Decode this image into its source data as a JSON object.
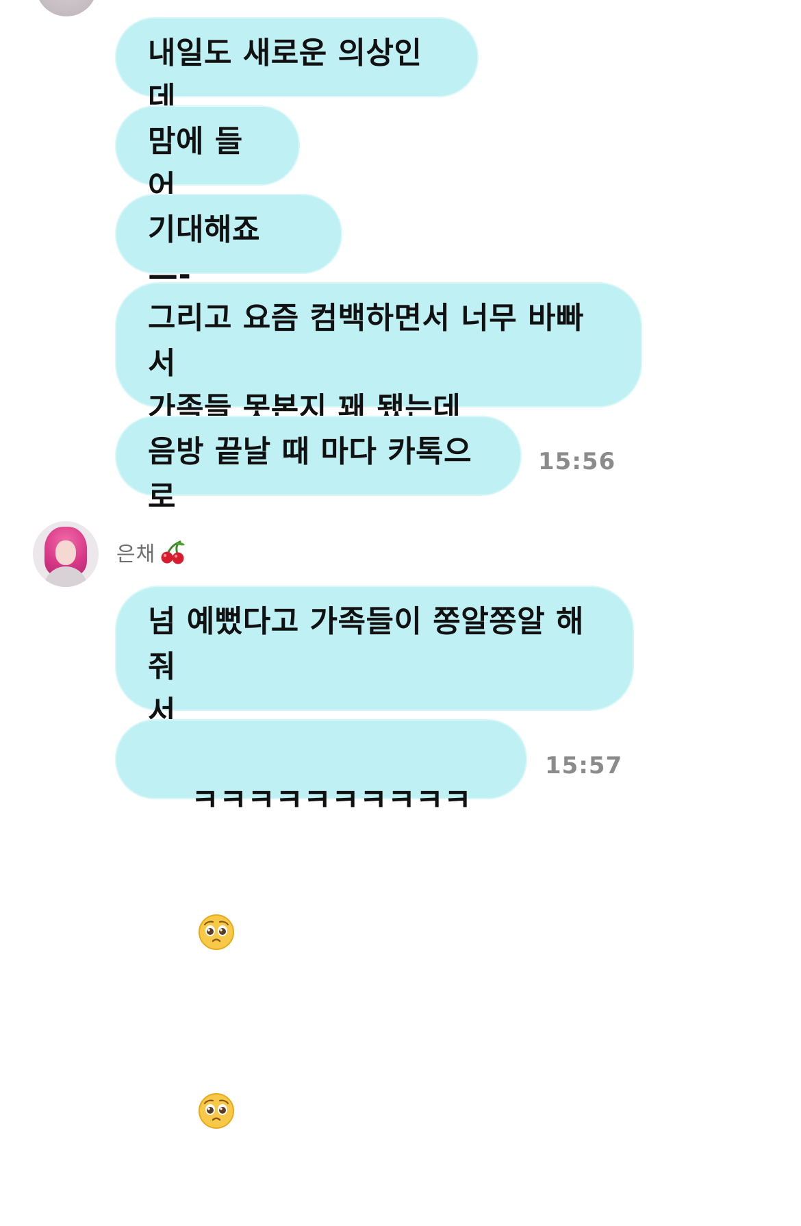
{
  "messages_before": [
    "내일도 새로운 의상인데",
    "맘에 들어",
    "기대해죠 —-",
    "그리고 요즘 컴백하면서 너무 바빠서\n가족들 못본지 꽤 됐는데",
    "음방 끝날 때 마다 카톡으로"
  ],
  "timestamp_1": "15:56",
  "sender": {
    "name": "은채"
  },
  "messages_after": [
    "넘 예뻤다고 가족들이 쫑알쫑알 해줘\n서",
    "ㅋㅋㅋㅋㅋㅋㅋㅋㅋㅋ"
  ],
  "timestamp_2": "15:57",
  "colors": {
    "bubble": "#bef0f4",
    "bubble_border": "#d7f7f8",
    "timestamp": "#8b8b8b",
    "sender_name": "#6f6f6f"
  },
  "icons": {
    "cherry": "cherry-icon",
    "pleading_face": "pleading-face-icon"
  }
}
